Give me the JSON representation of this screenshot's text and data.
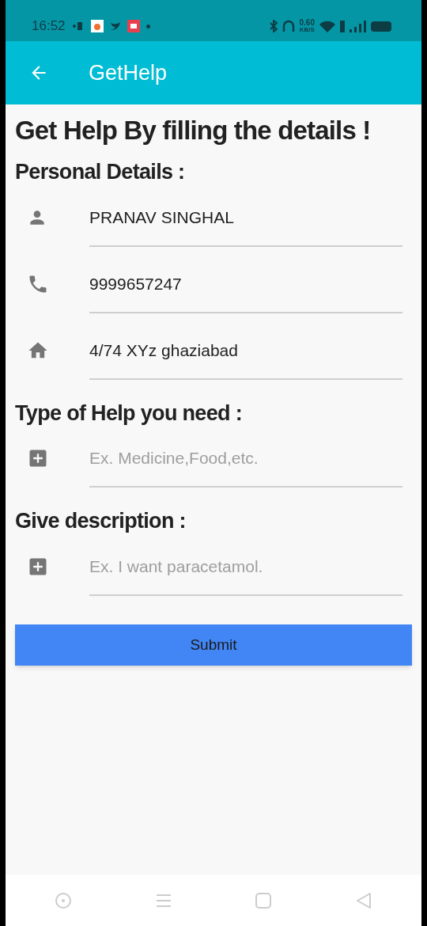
{
  "status_bar": {
    "time": "16:52",
    "speed": "0.60",
    "speed_unit": "KB/S"
  },
  "app_bar": {
    "title": "GetHelp"
  },
  "heading": "Get Help By filling the details !",
  "sections": [
    {
      "title": "Personal Details :",
      "fields": [
        {
          "kind": "person",
          "value": "PRANAV SINGHAL"
        },
        {
          "kind": "phone",
          "value": "9999657247"
        },
        {
          "kind": "home",
          "value": "4/74 XYz ghaziabad"
        }
      ]
    },
    {
      "title": "Type of Help you need :",
      "fields": [
        {
          "kind": "add",
          "placeholder": "Ex. Medicine,Food,etc."
        }
      ]
    },
    {
      "title": "Give description :",
      "fields": [
        {
          "kind": "add",
          "placeholder": "Ex. I want paracetamol."
        }
      ]
    }
  ],
  "submit": "Submit"
}
